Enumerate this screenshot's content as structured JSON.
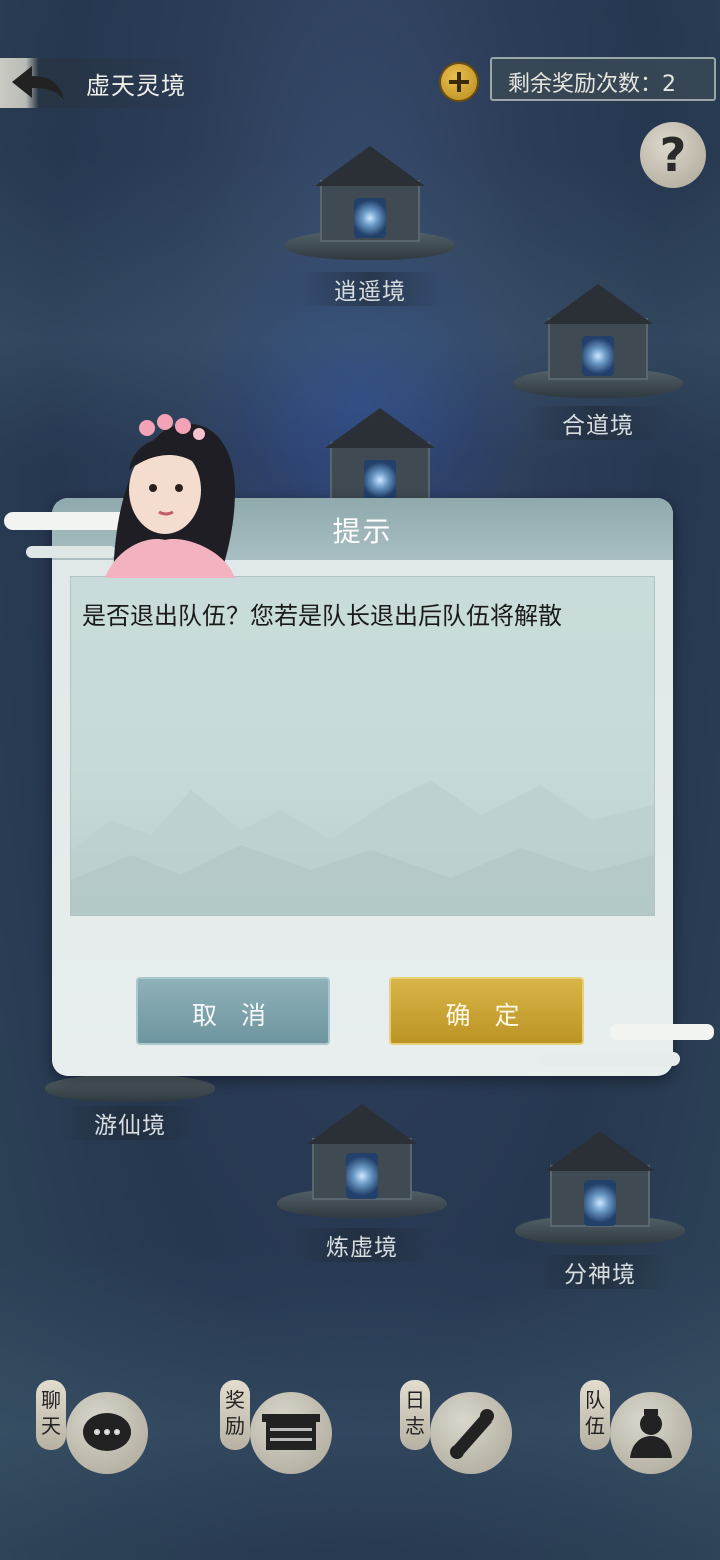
{
  "header": {
    "back_label": "虚天灵境",
    "reward_text": "剩余奖励次数：2",
    "help_symbol": "?"
  },
  "temples": [
    {
      "name": "逍遥境"
    },
    {
      "name": "合道境"
    },
    {
      "name": "游仙境"
    },
    {
      "name": "炼虚境"
    },
    {
      "name": "分神境"
    }
  ],
  "dialog": {
    "title": "提示",
    "message": "是否退出队伍？您若是队长退出后队伍将解散",
    "cancel_label": "取 消",
    "confirm_label": "确 定"
  },
  "bottom_nav": [
    {
      "label_top": "聊",
      "label_bottom": "天",
      "icon": "chat-icon"
    },
    {
      "label_top": "奖",
      "label_bottom": "励",
      "icon": "treasure-chest-icon"
    },
    {
      "label_top": "日",
      "label_bottom": "志",
      "icon": "scroll-icon"
    },
    {
      "label_top": "队",
      "label_bottom": "伍",
      "icon": "team-icon"
    }
  ]
}
